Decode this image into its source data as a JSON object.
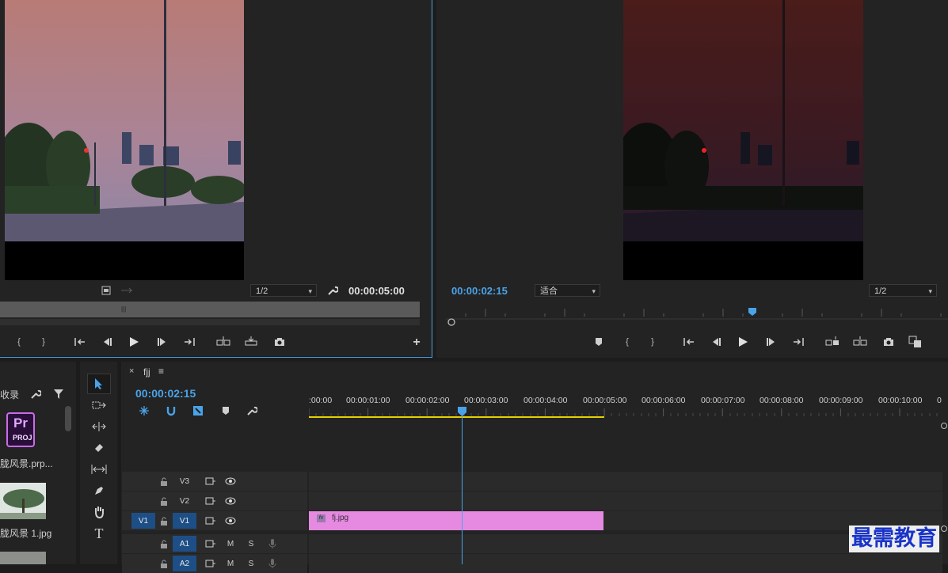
{
  "source_monitor": {
    "zoom_options_selected": "1/2",
    "duration": "00:00:05:00"
  },
  "program_monitor": {
    "timecode": "00:00:02:15",
    "fit_selected": "适合",
    "zoom_selected": "1/2"
  },
  "project_panel": {
    "label_fragment": "收录",
    "items": [
      {
        "name": "胧风景.prp...",
        "icon": "premiere-project-icon",
        "badge_top": "Pr",
        "badge_bottom": "PROJ"
      },
      {
        "name": "胧风景 1.jpg",
        "icon": "landscape-thumbnail"
      }
    ]
  },
  "timeline": {
    "tab_close": "×",
    "sequence_name": "fjj",
    "menu_icon": "≡",
    "timecode": "00:00:02:15",
    "ruler_labels": [
      ":00:00",
      "00:00:01:00",
      "00:00:02:00",
      "00:00:03:00",
      "00:00:04:00",
      "00:00:05:00",
      "00:00:06:00",
      "00:00:07:00",
      "00:00:08:00",
      "00:00:09:00",
      "00:00:10:00",
      "0"
    ],
    "tracks": {
      "video": [
        {
          "source": "",
          "name": "V3"
        },
        {
          "source": "",
          "name": "V2"
        },
        {
          "source": "V1",
          "name": "V1"
        }
      ],
      "audio": [
        {
          "source": "",
          "name": "A1",
          "mute": "M",
          "solo": "S"
        },
        {
          "source": "",
          "name": "A2",
          "mute": "M",
          "solo": "S"
        }
      ]
    },
    "clip": {
      "label": "fj.jpg",
      "fx": "fx",
      "color": "#e58ae0"
    }
  },
  "colors": {
    "accent_blue": "#4aa3e8",
    "work_area_yellow": "#e5d000",
    "active_track_blue": "#1d4f86"
  },
  "watermark": "最需教育"
}
